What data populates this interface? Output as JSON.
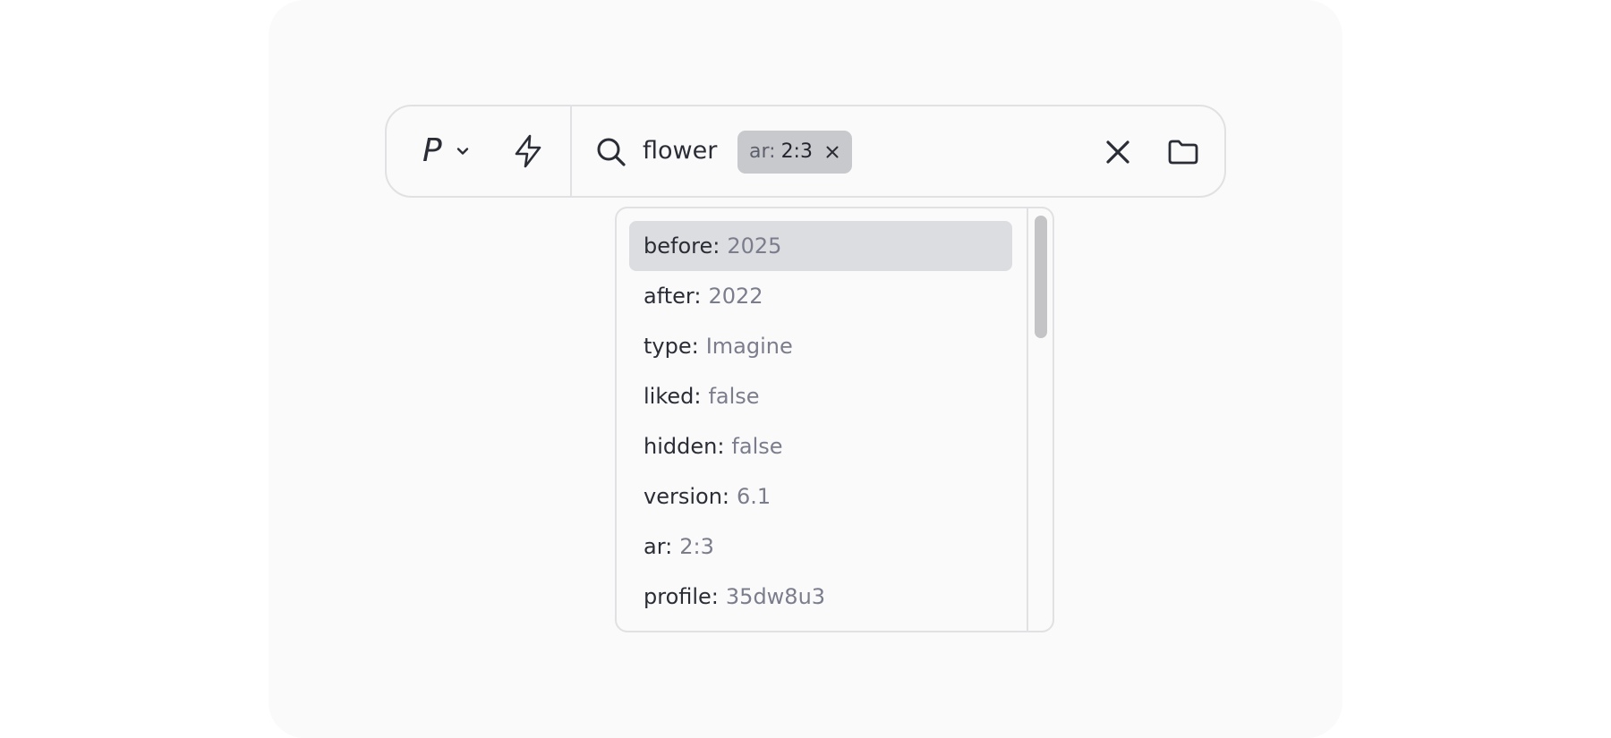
{
  "toolbar": {
    "profile_letter": "P",
    "icons": {
      "profile_dropdown": "chevron-down-icon",
      "mode": "lightning-bolt-icon",
      "search": "search-icon",
      "clear": "close-icon",
      "folder": "folder-icon"
    }
  },
  "search": {
    "query": "flower",
    "chip": {
      "key": "ar:",
      "value": "2:3"
    }
  },
  "suggestions": [
    {
      "key": "before:",
      "value": "2025",
      "active": true
    },
    {
      "key": "after:",
      "value": "2022",
      "active": false
    },
    {
      "key": "type:",
      "value": "Imagine",
      "active": false
    },
    {
      "key": "liked:",
      "value": "false",
      "active": false
    },
    {
      "key": "hidden:",
      "value": "false",
      "active": false
    },
    {
      "key": "version:",
      "value": "6.1",
      "active": false
    },
    {
      "key": "ar:",
      "value": "2:3",
      "active": false
    },
    {
      "key": "profile:",
      "value": "35dw8u3",
      "active": false
    }
  ],
  "scroll": {
    "visible_fraction": 0.3,
    "position": 0
  },
  "colors": {
    "text": "#2b2d36",
    "muted_value": "#7b7d8c",
    "chip_bg": "#c8c9cd",
    "active_row": "#dcdde1",
    "border": "#e1e1e3"
  }
}
